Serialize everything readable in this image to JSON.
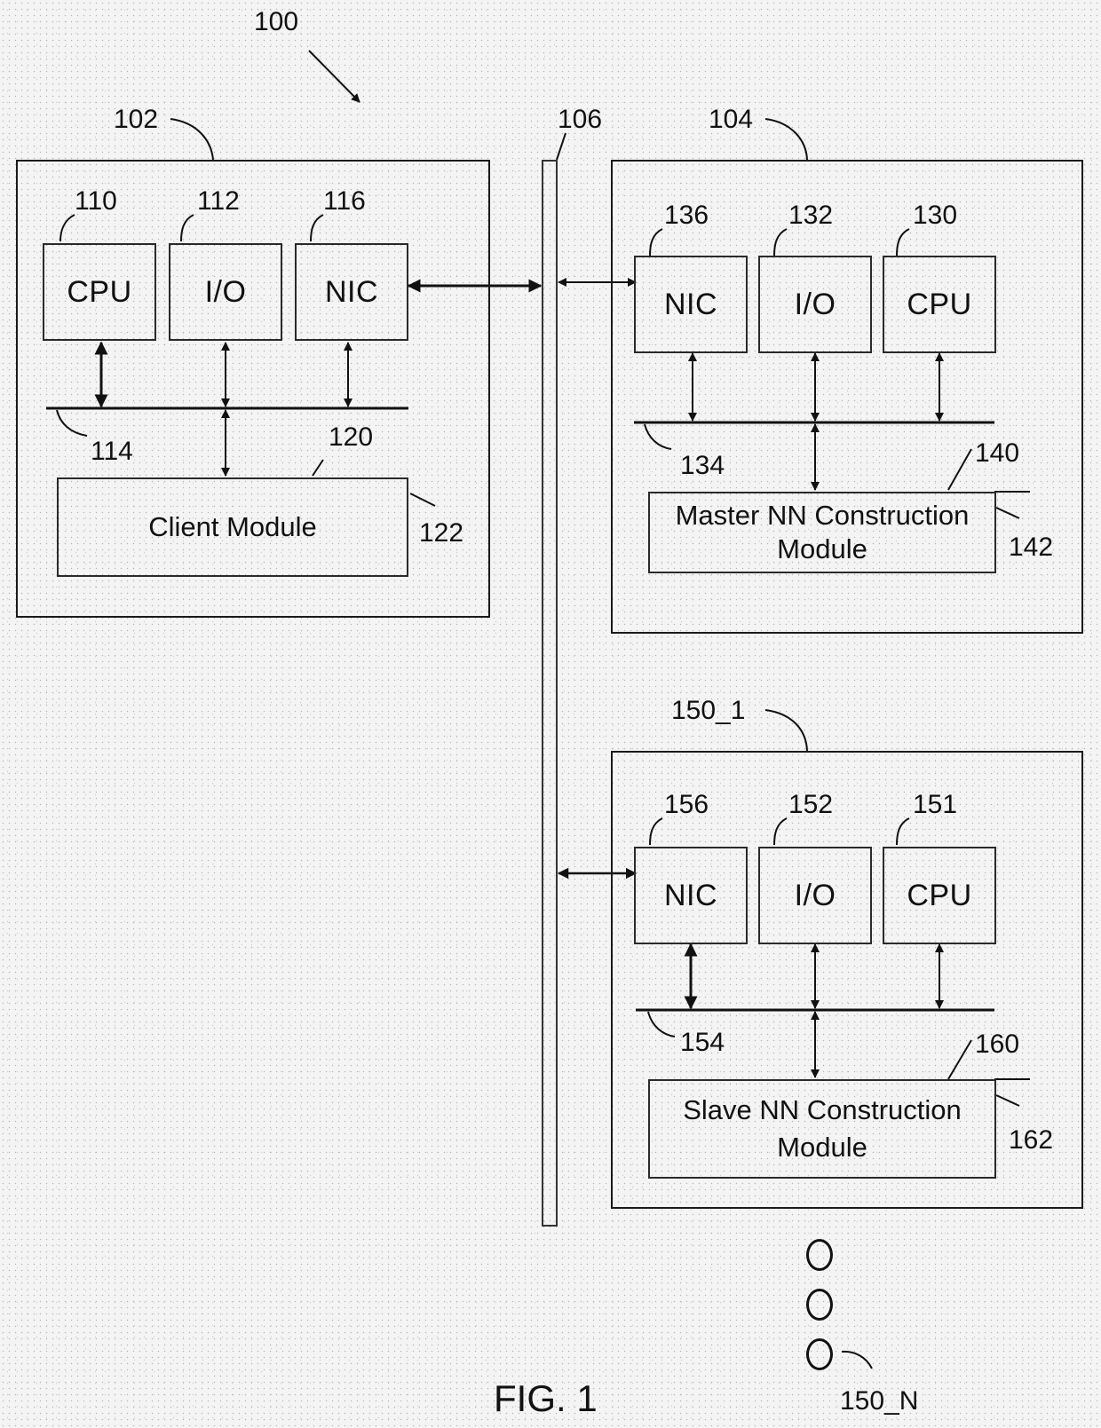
{
  "figure": {
    "title": "FIG. 1",
    "system_ref": "100"
  },
  "network": {
    "ref": "106"
  },
  "client_device": {
    "ref": "102",
    "components": [
      {
        "label": "CPU",
        "ref": "110"
      },
      {
        "label": "I/O",
        "ref": "112"
      },
      {
        "label": "NIC",
        "ref": "116"
      }
    ],
    "bus_ref": "114",
    "module": {
      "label": "Client Module",
      "ref": "120",
      "sub_ref": "122"
    }
  },
  "master_device": {
    "ref": "104",
    "components": [
      {
        "label": "NIC",
        "ref": "136"
      },
      {
        "label": "I/O",
        "ref": "132"
      },
      {
        "label": "CPU",
        "ref": "130"
      }
    ],
    "bus_ref": "134",
    "module": {
      "label_line1": "Master NN Construction",
      "label_line2": "Module",
      "ref": "140",
      "sub_ref": "142"
    }
  },
  "slave_device": {
    "ref": "150_1",
    "components": [
      {
        "label": "NIC",
        "ref": "156"
      },
      {
        "label": "I/O",
        "ref": "152"
      },
      {
        "label": "CPU",
        "ref": "151"
      }
    ],
    "bus_ref": "154",
    "module": {
      "label_line1": "Slave NN Construction",
      "label_line2": "Module",
      "ref": "160",
      "sub_ref": "162"
    }
  },
  "additional_slaves": {
    "ref": "150_N",
    "ellipsis_count": 3
  }
}
